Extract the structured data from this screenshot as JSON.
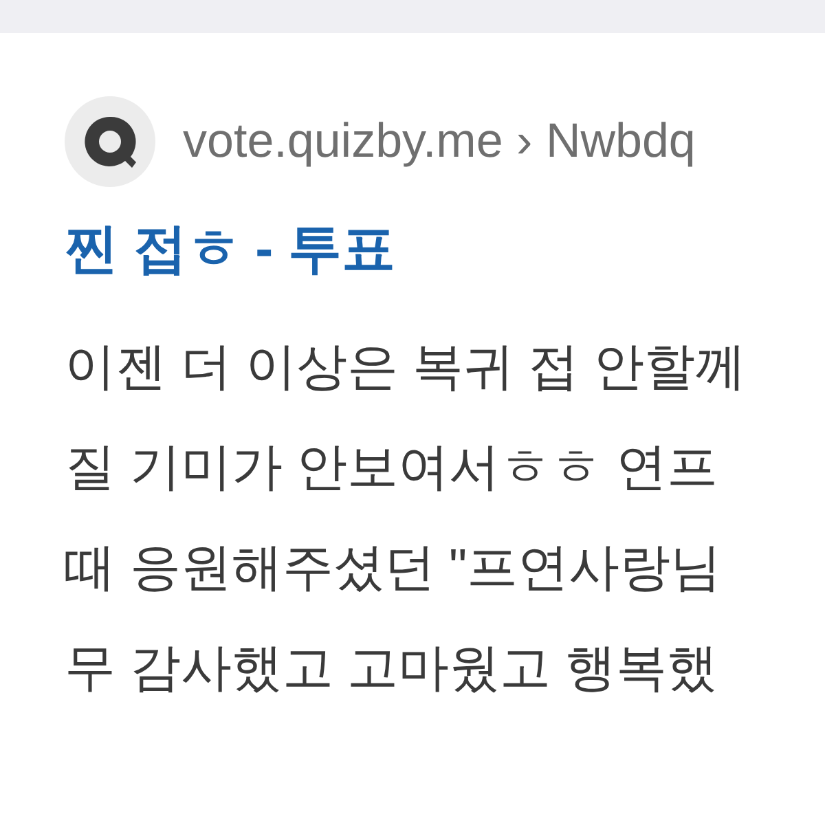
{
  "result": {
    "site": "vote.quizby.me",
    "separator": "›",
    "path": "Nwbdq",
    "title": "찐 접ㅎ - 투표",
    "snippet_lines": [
      "이젠 더 이상은 복귀 접 안할께",
      "질 기미가 안보여서ㅎㅎ 연프",
      "때 응원해주셨던 \"프연사랑님",
      "무 감사했고 고마웠고 행복했"
    ]
  }
}
